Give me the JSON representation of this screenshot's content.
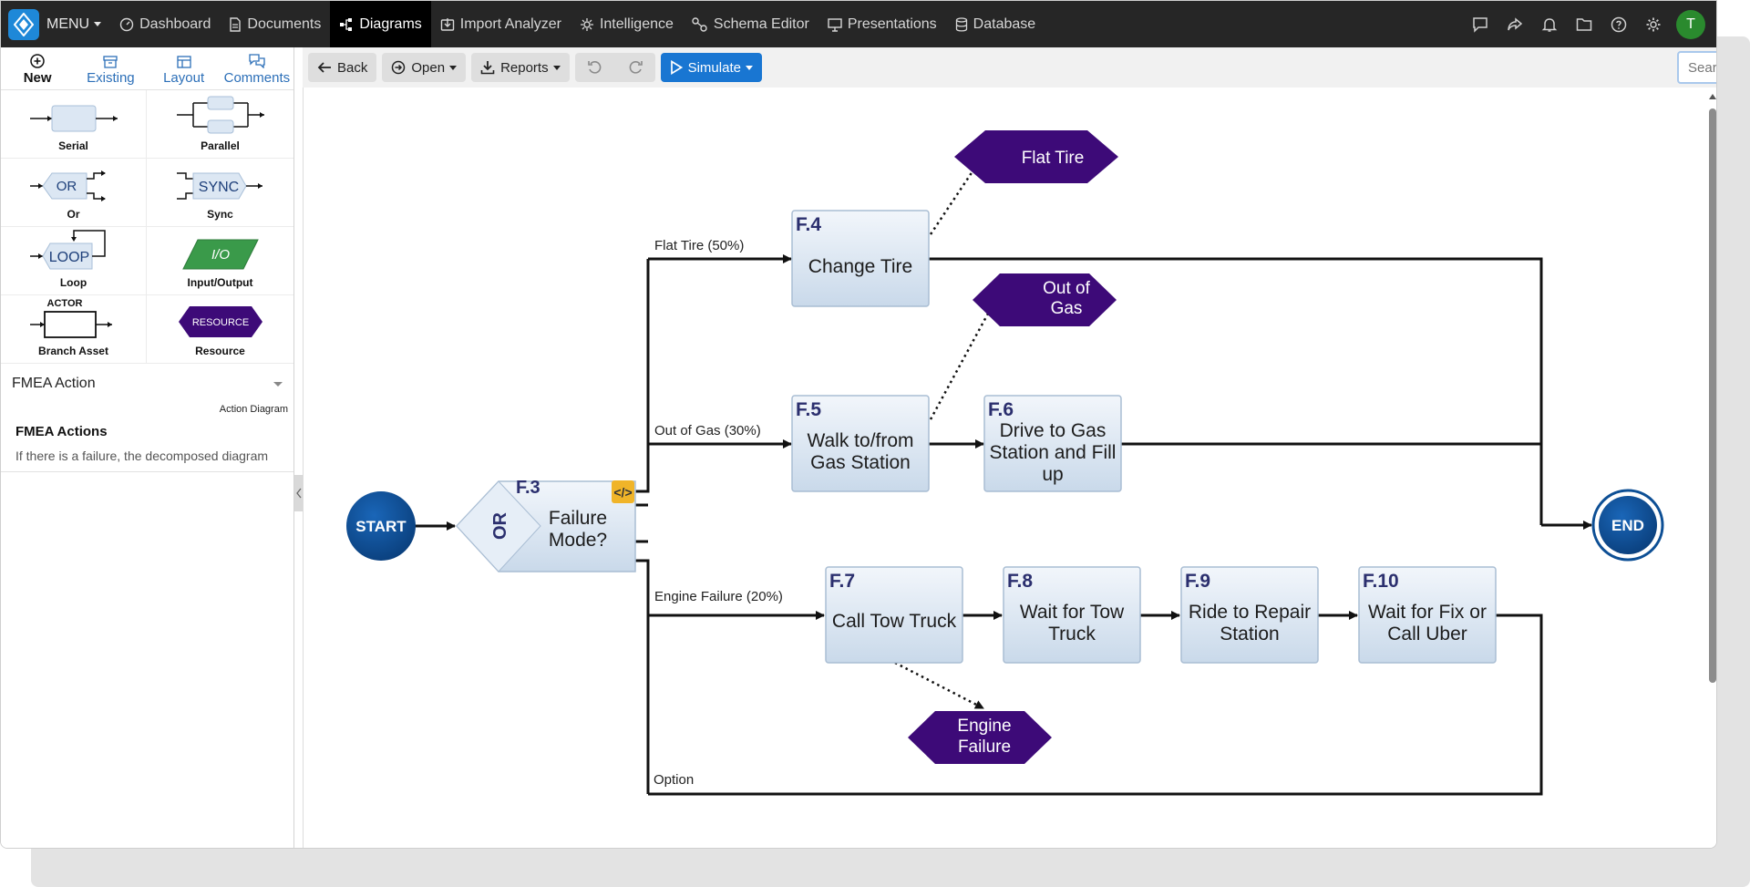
{
  "nav": {
    "menu_label": "MENU",
    "items": [
      {
        "label": "Dashboard",
        "icon": "dashboard-icon"
      },
      {
        "label": "Documents",
        "icon": "document-icon"
      },
      {
        "label": "Diagrams",
        "icon": "diagram-icon",
        "active": true
      },
      {
        "label": "Import Analyzer",
        "icon": "import-icon"
      },
      {
        "label": "Intelligence",
        "icon": "intelligence-icon"
      },
      {
        "label": "Schema Editor",
        "icon": "schema-icon"
      },
      {
        "label": "Presentations",
        "icon": "presentation-icon"
      },
      {
        "label": "Database",
        "icon": "database-icon"
      }
    ],
    "right_icons": [
      "chat-icon",
      "share-icon",
      "bell-icon",
      "folder-icon",
      "help-icon",
      "gear-icon"
    ],
    "avatar_initial": "T"
  },
  "left": {
    "tabs": [
      {
        "label": "New",
        "icon": "plus-circle-icon",
        "active": true
      },
      {
        "label": "Existing",
        "icon": "archive-icon"
      },
      {
        "label": "Layout",
        "icon": "layout-icon"
      },
      {
        "label": "Comments",
        "icon": "comments-icon"
      }
    ],
    "palette": [
      {
        "label": "Serial"
      },
      {
        "label": "Parallel"
      },
      {
        "label": "Or",
        "glyph": "OR"
      },
      {
        "label": "Sync",
        "glyph": "SYNC"
      },
      {
        "label": "Loop",
        "glyph": "LOOP"
      },
      {
        "label": "Input/Output",
        "glyph": "I/O"
      },
      {
        "label": "Branch Asset",
        "glyph": "ACTOR"
      },
      {
        "label": "Resource",
        "glyph": "RESOURCE"
      }
    ],
    "select_value": "FMEA Action",
    "sub_label": "Action Diagram",
    "fmea_title": "FMEA Actions",
    "fmea_text": "If there is a failure, the decomposed diagram"
  },
  "toolbar": {
    "back": "Back",
    "open": "Open",
    "reports": "Reports",
    "simulate": "Simulate",
    "search_placeholder": "Search the Diagram..."
  },
  "diagram": {
    "start": "START",
    "end": "END",
    "or_node": {
      "id": "F.3",
      "or_label": "OR",
      "title_lines": [
        "Failure",
        "Mode?"
      ]
    },
    "nodes": [
      {
        "id": "F.4",
        "lines": [
          "Change Tire"
        ]
      },
      {
        "id": "F.5",
        "lines": [
          "Walk to/from",
          "Gas Station"
        ]
      },
      {
        "id": "F.6",
        "lines": [
          "Drive to Gas",
          "Station and Fill",
          "up"
        ]
      },
      {
        "id": "F.7",
        "lines": [
          "Call Tow Truck"
        ]
      },
      {
        "id": "F.8",
        "lines": [
          "Wait for Tow",
          "Truck"
        ]
      },
      {
        "id": "F.9",
        "lines": [
          "Ride to Repair",
          "Station"
        ]
      },
      {
        "id": "F.10",
        "lines": [
          "Wait for Fix or",
          "Call Uber"
        ]
      }
    ],
    "resources": [
      {
        "lines": [
          "Flat Tire"
        ]
      },
      {
        "lines": [
          "Out of",
          "Gas"
        ]
      },
      {
        "lines": [
          "Engine",
          "Failure"
        ]
      }
    ],
    "branch_labels": [
      "Flat Tire (50%)",
      "Out of Gas (30%)",
      "Engine Failure (20%)",
      "Option"
    ],
    "colors": {
      "node_fill": "#d9e6f3",
      "resource": "#3d0a78",
      "start": "#0d4f95",
      "accent": "#f0b429"
    }
  }
}
